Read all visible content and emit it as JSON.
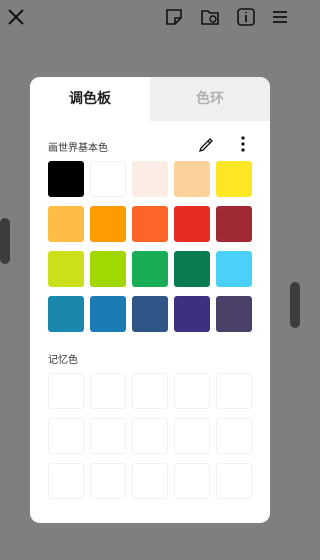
{
  "topbar": {
    "icons": [
      "close-icon",
      "sticker-icon",
      "folder-icon",
      "info-icon",
      "menu-icon"
    ]
  },
  "panel": {
    "tabs": [
      {
        "label": "调色板",
        "active": true
      },
      {
        "label": "色环",
        "active": false
      }
    ],
    "basic_colors_title": "画世界基本色",
    "tools": [
      "eyedropper-icon",
      "more-vertical-icon"
    ],
    "basic_colors": [
      "#000000",
      "#ffffff",
      "#fbede6",
      "#fcd29b",
      "#fde725",
      "#fdbc45",
      "#fd9c00",
      "#fd6428",
      "#e62d23",
      "#a02a33",
      "#cbe01b",
      "#a1d804",
      "#19ad56",
      "#0a7c51",
      "#4bd0f7",
      "#1a88ac",
      "#1b7cb5",
      "#2e5687",
      "#3f2f83",
      "#4b4068"
    ],
    "memory_title": "记忆色",
    "memory_colors": [
      "",
      "",
      "",
      "",
      "",
      "",
      "",
      "",
      "",
      "",
      "",
      "",
      "",
      "",
      ""
    ]
  },
  "colors": {
    "overlay": "#7f7f7f",
    "panel_bg": "#ffffff",
    "inactive_tab_bg": "#efefef"
  }
}
